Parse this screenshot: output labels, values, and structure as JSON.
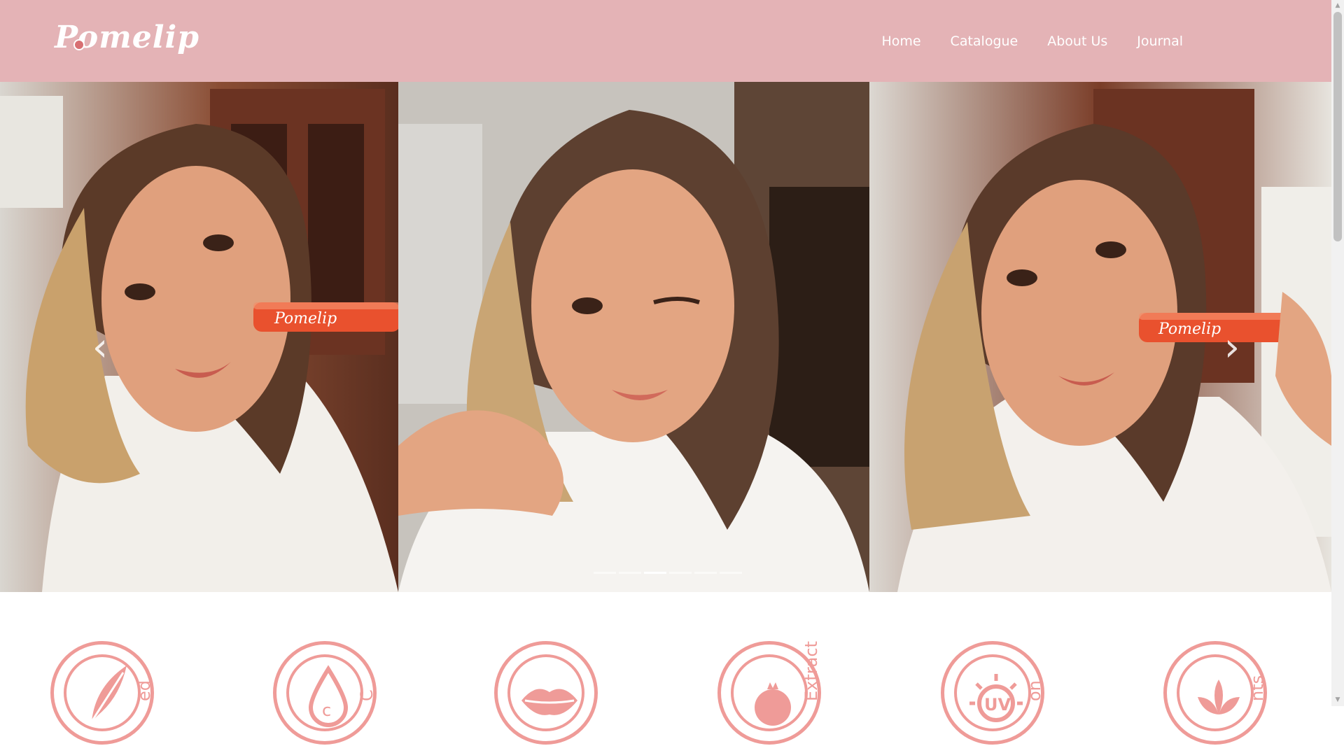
{
  "brand": {
    "logo_text": "Pomelip"
  },
  "nav": {
    "items": [
      {
        "label": "Home"
      },
      {
        "label": "Catalogue"
      },
      {
        "label": "About Us"
      },
      {
        "label": "Journal"
      }
    ]
  },
  "carousel": {
    "prev_symbol": "‹",
    "next_symbol": "›",
    "slide_count": 6,
    "active_index": 2,
    "slides": [
      {
        "product_text": "Pomelip"
      },
      {
        "product_text": ""
      },
      {
        "product_text": "Pomelip"
      }
    ]
  },
  "features": [
    {
      "icon": "feather-icon",
      "label": "ed"
    },
    {
      "icon": "vitamin-c-drop-icon",
      "label": "C"
    },
    {
      "icon": "lips-icon",
      "label": ""
    },
    {
      "icon": "pomegranate-icon",
      "label": "Extract"
    },
    {
      "icon": "uv-protection-icon",
      "label": "on"
    },
    {
      "icon": "leaf-icon",
      "label": "nts"
    }
  ],
  "colors": {
    "header_bg": "#e4b3b6",
    "accent_pink": "#ef9b98",
    "nav_text": "#ffffff"
  }
}
